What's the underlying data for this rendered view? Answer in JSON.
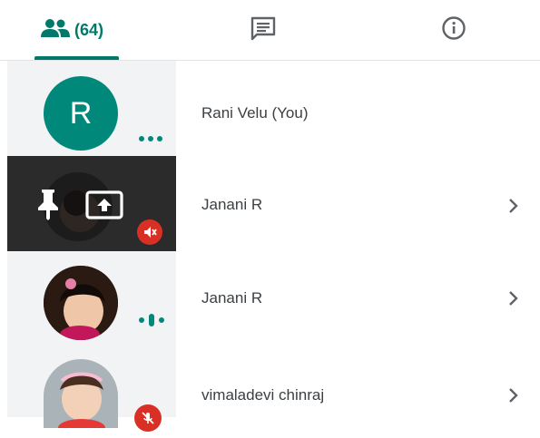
{
  "tabs": {
    "people_count": "(64)",
    "active": "people",
    "people_icon": "people-icon",
    "chat_icon": "chat-icon",
    "info_icon": "info-icon"
  },
  "participants": [
    {
      "name": "Rani Velu (You)",
      "avatar_letter": "R",
      "indicator": "more-dots-icon"
    },
    {
      "name": "Janani R",
      "state": "presenting",
      "icons": [
        "pin-icon",
        "present-screen-icon",
        "muted-icon"
      ]
    },
    {
      "name": "Janani R",
      "indicator": "speaking-icon"
    },
    {
      "name": "vimaladevi chinraj",
      "indicator": "muted-icon"
    }
  ],
  "colors": {
    "accent": "#00796b",
    "avatar": "#00897b",
    "muted": "#d93025",
    "panel": "#f1f3f4"
  }
}
